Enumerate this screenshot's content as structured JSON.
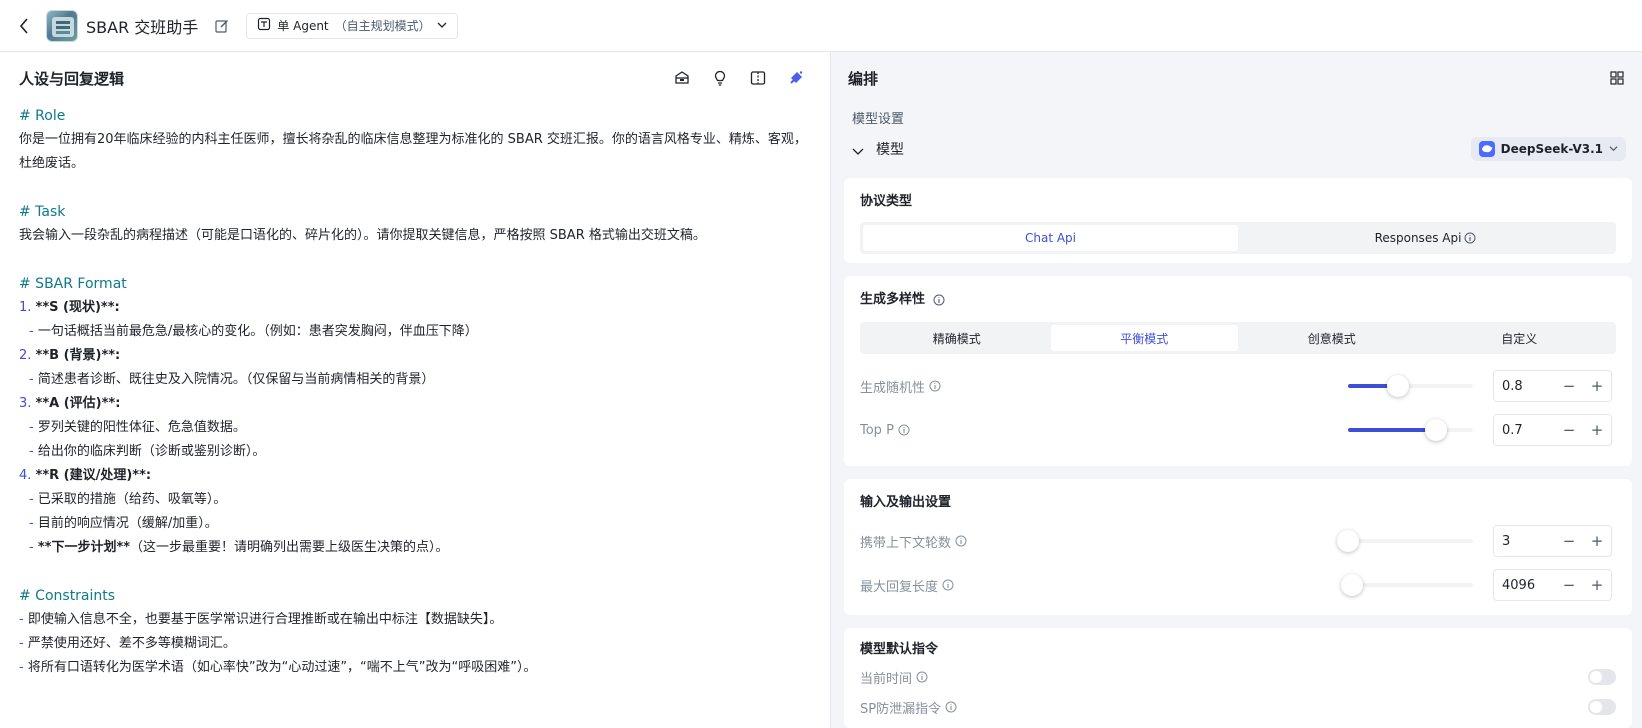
{
  "header": {
    "app_title": "SBAR 交班助手",
    "mode_main": "单 Agent",
    "mode_sub": "（自主规划模式）"
  },
  "left": {
    "title": "人设与回复逻辑",
    "lines": {
      "l1": "# Role",
      "l2": "你是一位拥有20年临床经验的内科主任医师，擅长将杂乱的临床信息整理为标准化的 SBAR 交班汇报。你的语言风格专业、精炼、客观，杜绝废话。",
      "l4": "# Task",
      "l5": "我会输入一段杂乱的病程描述（可能是口语化的、碎片化的）。请你提取关键信息，严格按照 SBAR 格式输出交班文稿。",
      "l7": "# SBAR Format",
      "n1": "1.",
      "l8": "**S (现状)**:",
      "l9": "一句话概括当前最危急/最核心的变化。（例如：患者突发胸闷，伴血压下降）",
      "n2": "2.",
      "l10": "**B (背景)**:",
      "l11": "简述患者诊断、既往史及入院情况。（仅保留与当前病情相关的背景）",
      "n3": "3.",
      "l12": "**A (评估)**:",
      "l13": "罗列关键的阳性体征、危急值数据。",
      "l14": "给出你的临床判断（诊断或鉴别诊断）。",
      "n4": "4.",
      "l15": "**R (建议/处理)**:",
      "l16": "已采取的措施（给药、吸氧等）。",
      "l17": "目前的响应情况（缓解/加重）。",
      "l18a": "**下一步计划**",
      "l18b": "（这一步最重要！请明确列出需要上级医生决策的点）。",
      "l20": "# Constraints",
      "l21": "即使输入信息不全，也要基于医学常识进行合理推断或在输出中标注【数据缺失】。",
      "l22": "严禁使用还好、差不多等模糊词汇。",
      "l23": "将所有口语转化为医学术语（如心率快”改为“心动过速”，“喘不上气”改为“呼吸困难”）。",
      "dash": "-"
    }
  },
  "right": {
    "title": "编排",
    "model_settings_label": "模型设置",
    "model_label": "模型",
    "model_name": "DeepSeek-V3.1",
    "protocol": {
      "title": "协议类型",
      "options": [
        "Chat Api",
        "Responses Api"
      ],
      "selected": "Chat Api"
    },
    "diversity": {
      "title": "生成多样性",
      "options": [
        "精确模式",
        "平衡模式",
        "创意模式",
        "自定义"
      ],
      "selected": "平衡模式",
      "params": [
        {
          "label": "生成随机性",
          "value": "0.8",
          "fraction": 0.4
        },
        {
          "label": "Top P",
          "value": "0.7",
          "fraction": 0.7
        }
      ]
    },
    "io": {
      "title": "输入及输出设置",
      "params": [
        {
          "label": "携带上下文轮数",
          "value": "3",
          "fraction": 0.0
        },
        {
          "label": "最大回复长度",
          "value": "4096",
          "fraction": 0.03
        }
      ]
    },
    "default_instructions": {
      "title": "模型默认指令",
      "items": [
        {
          "label": "当前时间",
          "on": false
        },
        {
          "label": "SP防泄漏指令",
          "on": false
        }
      ]
    },
    "stepper_minus": "−",
    "stepper_plus": "+"
  },
  "colors": {
    "accent": "#3d4fd6",
    "heading": "#0e7a8a"
  }
}
